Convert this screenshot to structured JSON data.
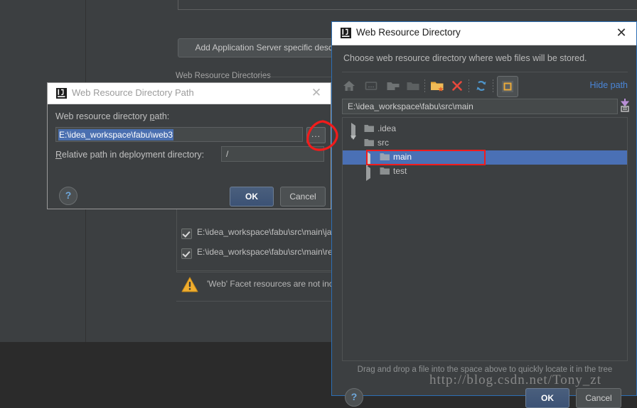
{
  "background": {
    "add_descriptor_button": "Add Application Server specific descriptor...",
    "section_title": "Web Resource Directories",
    "list_rows": [
      {
        "label": "E:\\idea_workspace\\fabu\\src\\main\\java",
        "checked": true
      },
      {
        "label": "E:\\idea_workspace\\fabu\\src\\main\\resources",
        "checked": true
      }
    ],
    "warning_text": "'Web' Facet resources are not included in an artifact",
    "warning_icon": "warning-triangle-icon"
  },
  "path_dialog": {
    "title": "Web Resource Directory Path",
    "title_icon": "intellij-idea-icon",
    "close_icon": "close-icon",
    "field1_label": "Web resource directory path:",
    "field1_value": "E:\\idea_workspace\\fabu\\web3",
    "browse_button": "...",
    "field2_label": "Relative path in deployment directory:",
    "field2_value": "/",
    "help_icon": "question-mark-icon",
    "ok_label": "OK",
    "cancel_label": "Cancel"
  },
  "chooser_dialog": {
    "title": "Web Resource Directory",
    "title_icon": "intellij-idea-icon",
    "close_icon": "close-icon",
    "description": "Choose web resource directory where web files will be stored.",
    "toolbar": [
      {
        "name": "home-icon",
        "enabled": true
      },
      {
        "name": "desktop-icon",
        "enabled": false
      },
      {
        "name": "project-folder-icon",
        "enabled": false
      },
      {
        "name": "module-folder-icon",
        "enabled": false
      },
      {
        "name": "new-folder-icon",
        "enabled": true
      },
      {
        "name": "delete-icon",
        "enabled": true
      },
      {
        "name": "refresh-icon",
        "enabled": true
      },
      {
        "name": "show-hidden-files-icon",
        "enabled": true
      }
    ],
    "hide_path_link": "Hide path",
    "path_value": "E:\\idea_workspace\\fabu\\src\\main",
    "path_drop_icon": "paste-from-clipboard-icon",
    "tree": [
      {
        "label": ".idea",
        "depth": 0,
        "expanded": false,
        "selected": false,
        "icon": "folder-icon"
      },
      {
        "label": "src",
        "depth": 0,
        "expanded": true,
        "selected": false,
        "icon": "folder-icon"
      },
      {
        "label": "main",
        "depth": 1,
        "expanded": false,
        "selected": true,
        "icon": "folder-icon"
      },
      {
        "label": "test",
        "depth": 1,
        "expanded": false,
        "selected": false,
        "icon": "folder-icon"
      }
    ],
    "hint": "Drag and drop a file into the space above to quickly locate it in the tree",
    "help_icon": "question-mark-icon",
    "ok_label": "OK",
    "cancel_label": "Cancel"
  },
  "annotation": {
    "red_circle": "red-hand-drawn-circle",
    "watermark": "http://blog.csdn.net/Tony_zt"
  },
  "colors": {
    "panel": "#3c3f41",
    "accent_selection": "#4a70b5",
    "link": "#4a86d8",
    "annotation_red": "#f21b1b",
    "warning_amber": "#f0ad2e",
    "active_border": "#2d6fb5"
  }
}
